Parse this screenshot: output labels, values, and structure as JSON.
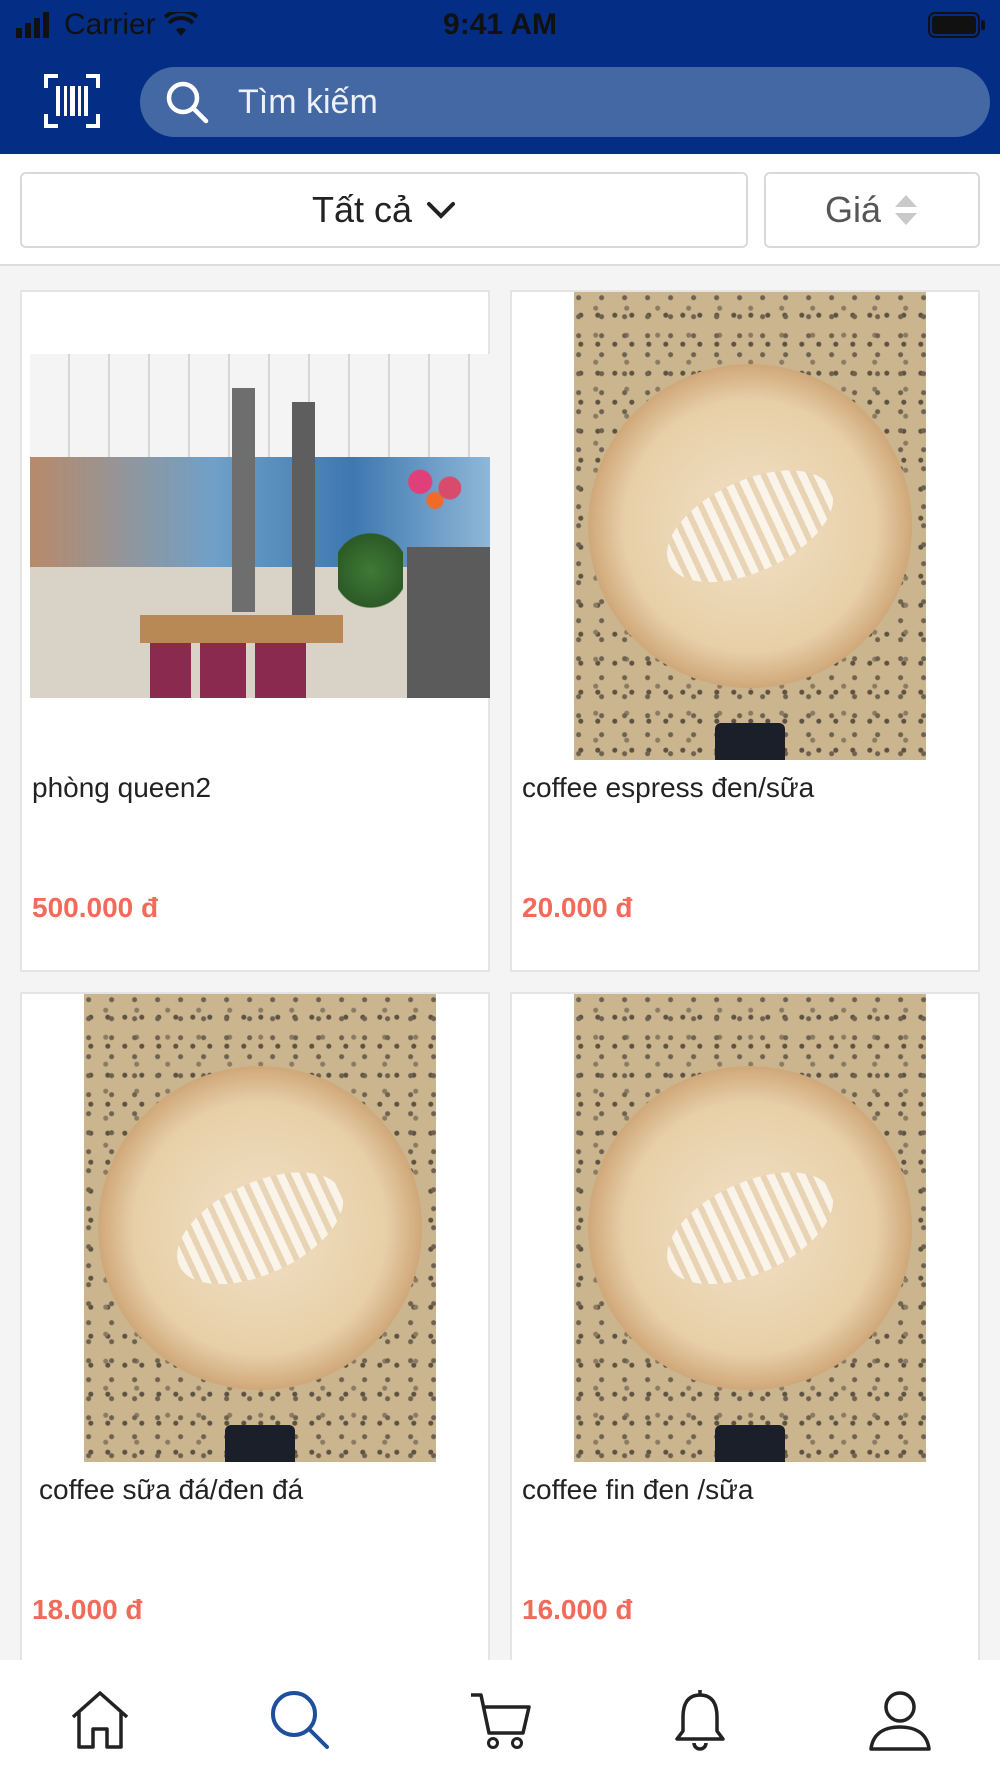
{
  "status_bar": {
    "carrier": "Carrier",
    "time": "9:41 AM"
  },
  "header": {
    "search_placeholder": "Tìm kiếm"
  },
  "filters": {
    "category_label": "Tất cả",
    "sort_label": "Giá"
  },
  "products": [
    {
      "name": "phòng queen2",
      "price": "500.000 đ"
    },
    {
      "name": "coffee espress đen/sữa",
      "price": "20.000 đ"
    },
    {
      "name": "coffee sữa đá/đen đá",
      "price": "18.000 đ"
    },
    {
      "name": "coffee fin đen /sữa",
      "price": "16.000 đ"
    }
  ],
  "tabbar": {
    "active_tab": "search",
    "icons": [
      "home-icon",
      "search-icon",
      "cart-icon",
      "bell-icon",
      "user-icon"
    ]
  },
  "colors": {
    "header_bg": "#042e85",
    "search_bg": "#4468a4",
    "price": "#f26a5a",
    "tab_active": "#1d4f9c",
    "tab_inactive": "#222222"
  }
}
